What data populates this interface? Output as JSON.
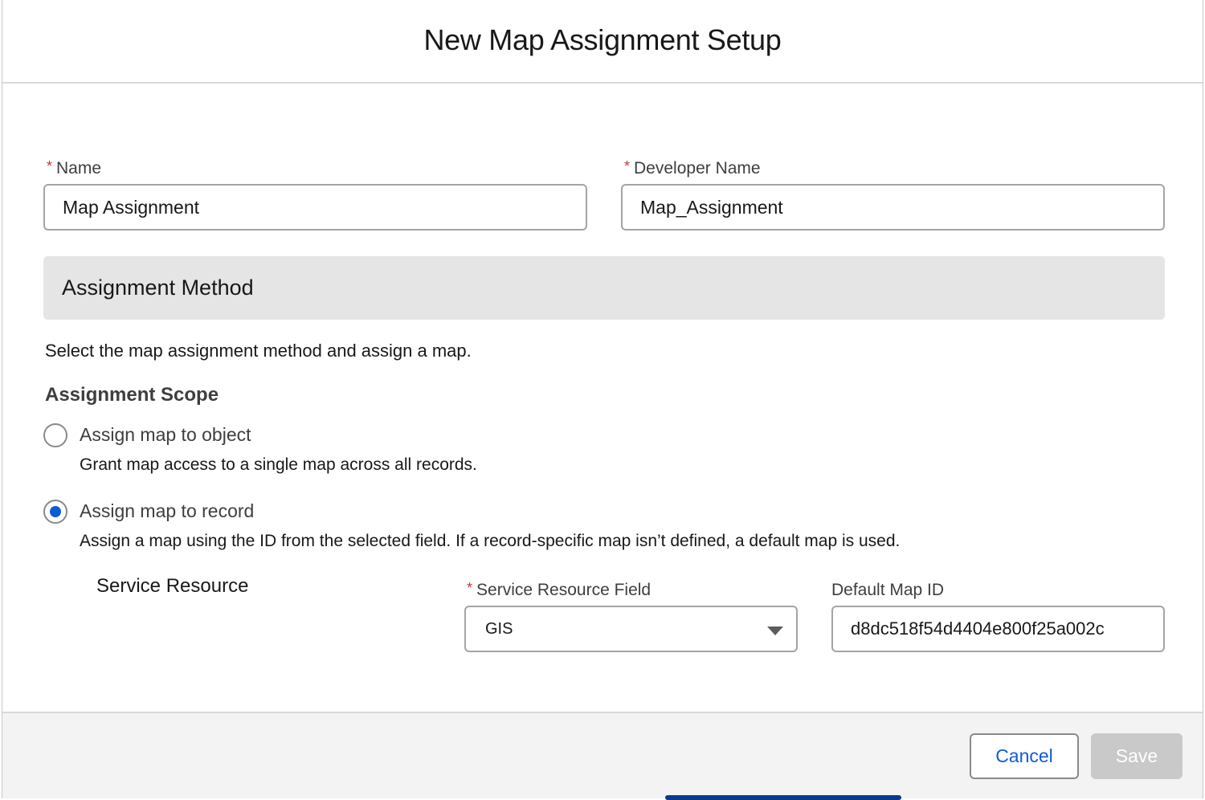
{
  "modal": {
    "title": "New Map Assignment Setup"
  },
  "fields": {
    "name": {
      "label": "Name",
      "required_marker": "*",
      "value": "Map Assignment"
    },
    "developer_name": {
      "label": "Developer Name",
      "required_marker": "*",
      "value": "Map_Assignment"
    }
  },
  "assignment_method": {
    "section_title": "Assignment Method",
    "help_text": "Select the map assignment method and assign a map.",
    "scope_heading": "Assignment Scope",
    "options": [
      {
        "label": "Assign map to object",
        "description": "Grant map access to a single map across all records.",
        "checked": false
      },
      {
        "label": "Assign map to record",
        "description": "Assign a map using the ID from the selected field. If a record-specific map isn’t defined, a default map is used.",
        "checked": true
      }
    ]
  },
  "service_resource": {
    "label": "Service Resource",
    "field": {
      "label": "Service Resource Field",
      "required_marker": "*",
      "selected_value": "GIS"
    },
    "default_map_id": {
      "label": "Default Map ID",
      "value": "d8dc518f54d4404e800f25a002c"
    }
  },
  "footer": {
    "cancel_label": "Cancel",
    "save_label": "Save",
    "save_disabled": true
  },
  "colors": {
    "brand_blue": "#0b5cd5",
    "required_red": "#c23934",
    "section_band": "#e5e5e5",
    "footer_bg": "#f3f3f3"
  }
}
